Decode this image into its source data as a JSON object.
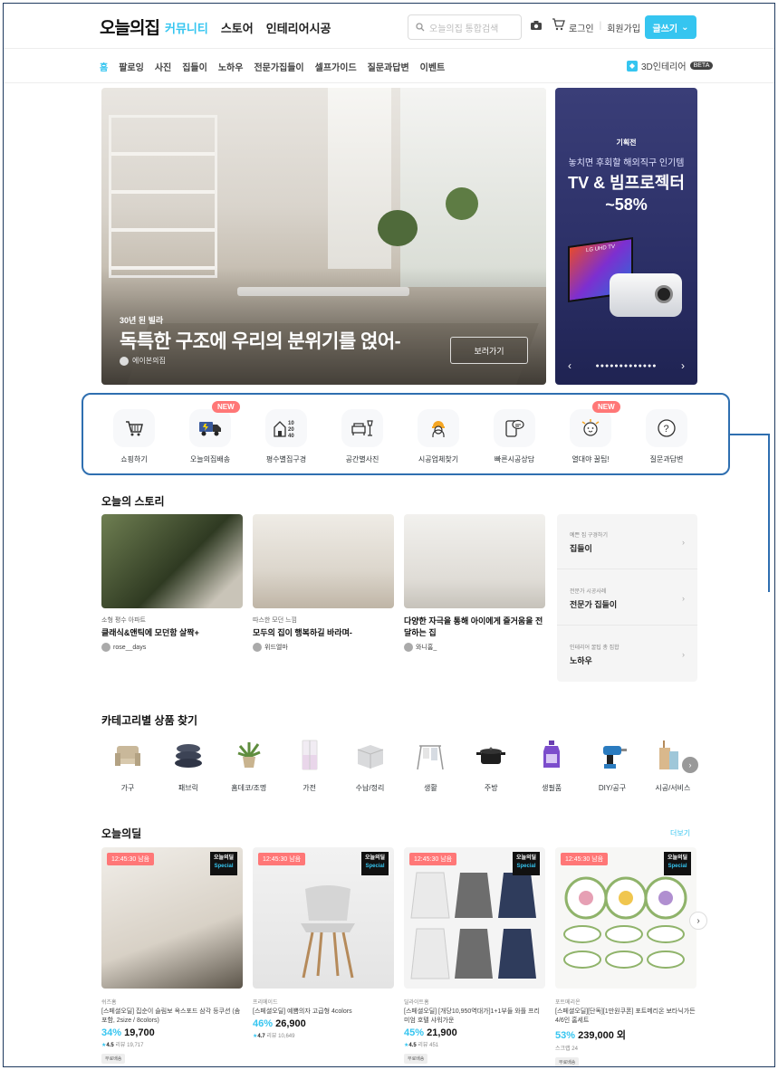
{
  "header": {
    "logo": "오늘의집",
    "menu": [
      "커뮤니티",
      "스토어",
      "인테리어시공"
    ],
    "active_menu_index": 0,
    "search_placeholder": "오늘의집 통합검색",
    "login": "로그인",
    "signup": "회원가입",
    "write": "글쓰기"
  },
  "subnav": {
    "items": [
      "홈",
      "팔로잉",
      "사진",
      "집들이",
      "노하우",
      "전문가집들이",
      "셀프가이드",
      "질문과답변",
      "이벤트"
    ],
    "active_index": 0,
    "three_d": "3D인테리어",
    "beta": "BETA"
  },
  "hero": {
    "subtitle": "30년 된 빌라",
    "title": "독특한 구조에 우리의 분위기를 얹어-",
    "user": "에이본의집",
    "button": "보러가기"
  },
  "promo": {
    "tag": "기획전",
    "subtitle": "놓치면 후회할 해외직구 인기템",
    "title_line1": "TV & 빔프로젝터",
    "title_line2": "~58%",
    "tv_text": "LG UHD TV"
  },
  "quick_menu": [
    {
      "label": "쇼핑하기",
      "icon": "cart-icon",
      "new": false
    },
    {
      "label": "오늘의집배송",
      "icon": "truck-icon",
      "new": true
    },
    {
      "label": "평수별집구경",
      "icon": "house-size-icon",
      "new": false
    },
    {
      "label": "공간별사진",
      "icon": "sofa-lamp-icon",
      "new": false
    },
    {
      "label": "시공업체찾기",
      "icon": "worker-icon",
      "new": false
    },
    {
      "label": "빠른시공상담",
      "icon": "chat-phone-icon",
      "new": false
    },
    {
      "label": "열대야 꿀팁!",
      "icon": "sun-face-icon",
      "new": true
    },
    {
      "label": "질문과답변",
      "icon": "question-icon",
      "new": false
    }
  ],
  "new_badge": "NEW",
  "house_size_numbers": [
    "10",
    "20",
    "40"
  ],
  "story": {
    "title": "오늘의 스토리",
    "cards": [
      {
        "category": "소형 평수 아파트",
        "title": "클래식&앤틱에 모던함 살짝+",
        "user": "rose__days"
      },
      {
        "category": "따스한 모던 느낌",
        "title": "모두의 집이 행복하길 바라며-",
        "user": "위드엘마"
      },
      {
        "category": "",
        "title": "다양한 자극을 통해 아이에게 즐거움을 전달하는 집",
        "user": "와니홈_"
      }
    ],
    "side": [
      {
        "small": "예쁜 집 구경하기",
        "big": "집들이"
      },
      {
        "small": "전문가 시공사례",
        "big": "전문가 집들이"
      },
      {
        "small": "인테리어 꿀팁 총 집합",
        "big": "노하우"
      }
    ]
  },
  "categories": {
    "title": "카테고리별 상품 찾기",
    "items": [
      "가구",
      "패브릭",
      "홈데코/조명",
      "가전",
      "수납/정리",
      "생활",
      "주방",
      "생필품",
      "DIY/공구",
      "시공/서비스"
    ]
  },
  "deals": {
    "title": "오늘의딜",
    "more": "더보기",
    "special_top": "오늘의딜",
    "special_bottom": "Special",
    "items": [
      {
        "timer": "12:45:30 남음",
        "brand": "쉬즈홈",
        "name": "[스페셜오딜] 집순이 슬림보 옥스포드 삼각 등쿠션 (솜포함, 2size / 8colors)",
        "pct": "34%",
        "price": "19,700",
        "rating": "4.5",
        "review": "리뷰 19,717",
        "ship": "무료배송"
      },
      {
        "timer": "12:45:30 남음",
        "brand": "프리메이드",
        "name": "[스페셜오딜] 예쁨의자 고급형 4colors",
        "pct": "46%",
        "price": "26,900",
        "rating": "4.7",
        "review": "리뷰 10,649",
        "ship": ""
      },
      {
        "timer": "12:45:30 남음",
        "brand": "딜라이트홈",
        "name": "[스페셜오딜] [개당10,950역대가]1+1부들 와플 프리미엄 호텔 샤워가운",
        "pct": "45%",
        "price": "21,900",
        "rating": "4.5",
        "review": "리뷰 451",
        "ship": "무료배송"
      },
      {
        "timer": "12:45:30 남음",
        "brand": "포트메리온",
        "name": "[스페셜오딜][단독][1만원쿠폰] 포트메리온 보타닉가든 4/6인 홈세트",
        "pct": "53%",
        "price": "239,000 외",
        "rating": "",
        "review": "스크랩 24",
        "ship": "무료배송"
      }
    ]
  }
}
